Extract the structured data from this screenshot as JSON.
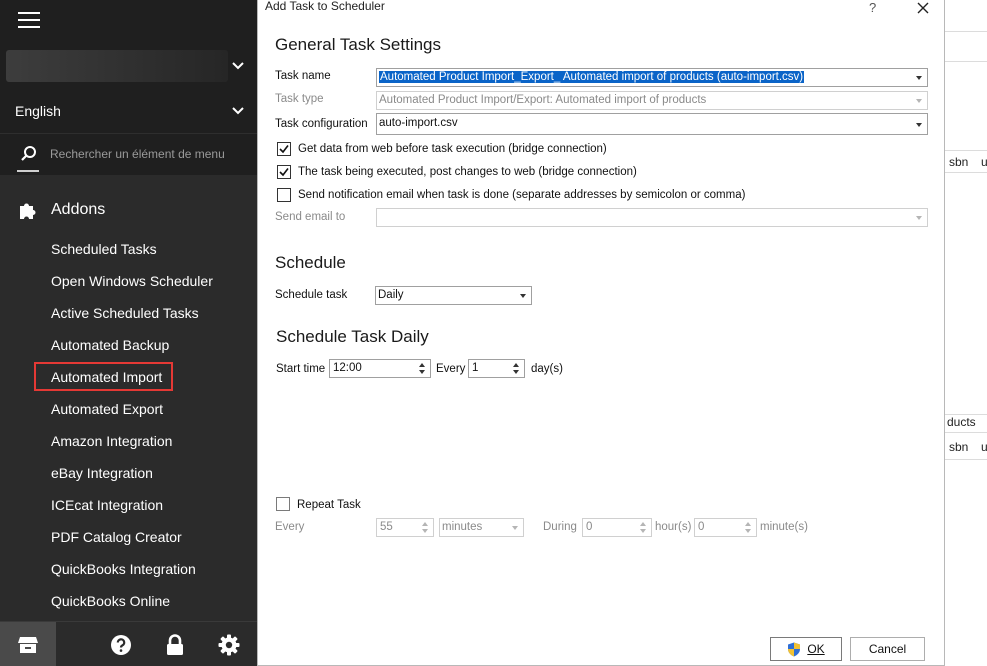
{
  "sidebar": {
    "language": "English",
    "search_placeholder": "Rechercher un élément de menu",
    "section_title": "Addons",
    "items": [
      {
        "label": "Scheduled Tasks"
      },
      {
        "label": "Open Windows Scheduler"
      },
      {
        "label": "Active Scheduled Tasks"
      },
      {
        "label": "Automated Backup"
      },
      {
        "label": "Automated Import",
        "highlighted": true
      },
      {
        "label": "Automated Export"
      },
      {
        "label": "Amazon Integration"
      },
      {
        "label": "eBay Integration"
      },
      {
        "label": "ICEcat Integration"
      },
      {
        "label": "PDF Catalog Creator"
      },
      {
        "label": "QuickBooks Integration"
      },
      {
        "label": "QuickBooks Online"
      }
    ],
    "highlight_color": "#e53935",
    "bottom_icons": [
      "store-icon",
      "help-icon",
      "lock-icon",
      "gear-icon"
    ]
  },
  "background": {
    "col_isbn": "sbn",
    "col_u": "u",
    "products_fragment": "ducts",
    "col_isbn_2": "sbn",
    "col_u_2": "u"
  },
  "dialog": {
    "title": "Add Task to Scheduler",
    "help_label": "?",
    "general": {
      "heading": "General Task Settings",
      "task_name_label": "Task name",
      "task_name_value": "Automated Product Import_Export_ Automated import of products (auto-import.csv)",
      "task_type_label": "Task type",
      "task_type_value": "Automated Product Import/Export: Automated import of products",
      "task_config_label": "Task configuration",
      "task_config_value": "auto-import.csv",
      "check_get_data": {
        "label": "Get data from web before task execution (bridge connection)",
        "checked": true
      },
      "check_post_changes": {
        "label": "The task being executed, post changes to web (bridge connection)",
        "checked": true
      },
      "check_send_email": {
        "label": "Send notification email when task is done (separate addresses by semicolon or comma)",
        "checked": false
      },
      "send_email_label": "Send email to",
      "send_email_value": ""
    },
    "schedule": {
      "heading": "Schedule",
      "schedule_task_label": "Schedule task",
      "schedule_task_value": "Daily"
    },
    "daily": {
      "heading": "Schedule Task Daily",
      "start_time_label": "Start time",
      "start_time_value": "12:00",
      "every_label": "Every",
      "every_value": "1",
      "days_label": "day(s)"
    },
    "repeat": {
      "check_label": "Repeat Task",
      "checked": false,
      "every_label": "Every",
      "every_value": "55",
      "unit_value": "minutes",
      "during_label": "During",
      "hours_value": "0",
      "hours_label": "hour(s)",
      "minutes_value": "0",
      "minutes_label": "minute(s)"
    },
    "buttons": {
      "ok_label": "OK",
      "cancel_label": "Cancel"
    }
  }
}
